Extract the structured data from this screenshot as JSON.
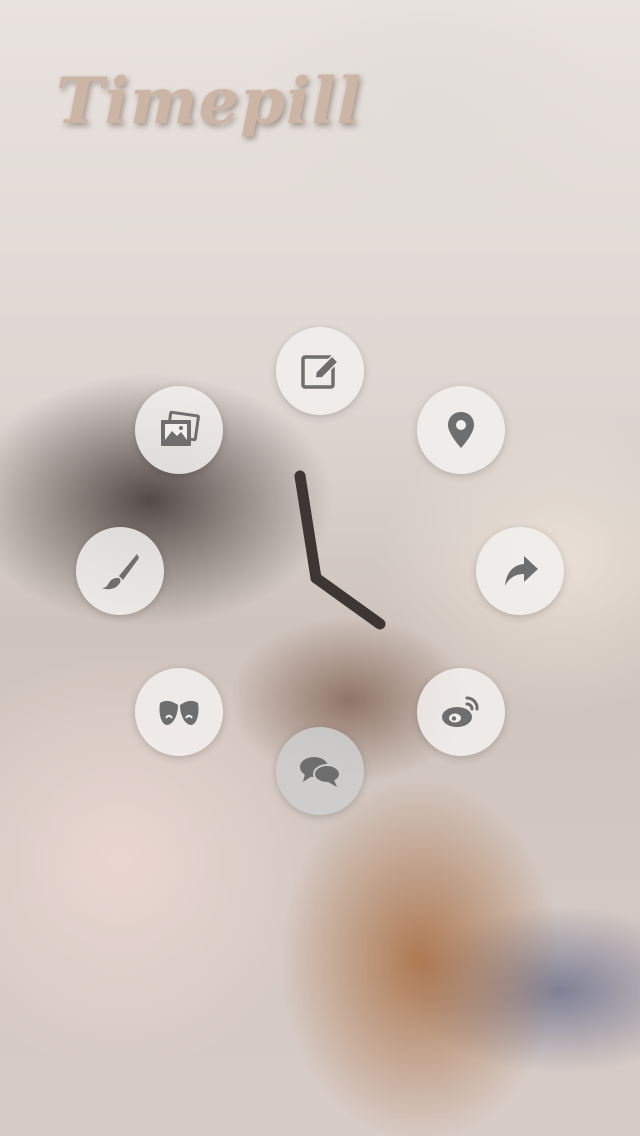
{
  "app": {
    "title": "Timepill"
  },
  "menu": {
    "items": [
      {
        "name": "write-button",
        "icon": "pencil-square-icon"
      },
      {
        "name": "location-button",
        "icon": "map-pin-icon"
      },
      {
        "name": "share-button",
        "icon": "share-arrow-icon"
      },
      {
        "name": "weibo-button",
        "icon": "weibo-icon"
      },
      {
        "name": "chat-button",
        "icon": "chat-bubbles-icon",
        "active": true
      },
      {
        "name": "douban-button",
        "icon": "masks-icon"
      },
      {
        "name": "paint-button",
        "icon": "paintbrush-icon"
      },
      {
        "name": "photo-button",
        "icon": "photos-icon"
      }
    ]
  },
  "colors": {
    "icon": "#6e6e6e",
    "clock_hand": "#3e3632",
    "title": "#cdb5a6"
  }
}
